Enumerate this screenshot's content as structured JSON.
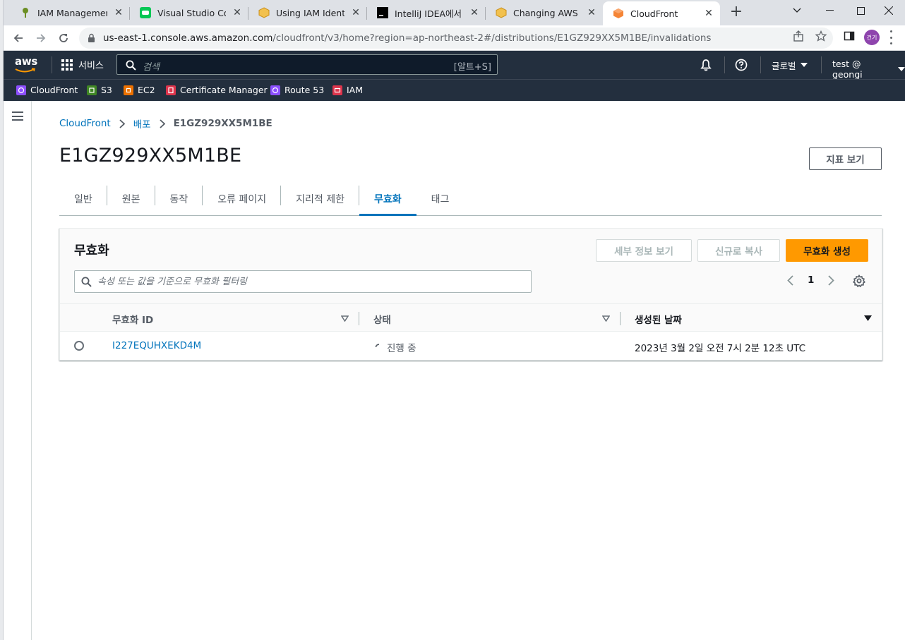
{
  "browser": {
    "tabs": [
      {
        "title": "IAM Management",
        "icon": "iam-favicon-icon"
      },
      {
        "title": "Visual Studio Code",
        "icon": "line-favicon-icon"
      },
      {
        "title": "Using IAM Identity",
        "icon": "aws-docs-favicon-icon"
      },
      {
        "title": "IntelliJ IDEA에서 AV",
        "icon": "terminal-favicon-icon"
      },
      {
        "title": "Changing AWS Reg",
        "icon": "aws-docs-favicon-icon"
      },
      {
        "title": "CloudFront",
        "icon": "cloudfront-favicon-icon",
        "active": true
      }
    ],
    "url_host": "us-east-1.console.aws.amazon.com",
    "url_path": "/cloudfront/v3/home?region=ap-northeast-2#/distributions/E1GZ929XX5M1BE/invalidations",
    "profile_initial": "건기"
  },
  "aws_nav": {
    "logo": "aws",
    "services_label": "서비스",
    "search_placeholder": "검색",
    "search_shortcut": "[알트+S]",
    "region_label": "글로벌",
    "account_label": "test @ geongi"
  },
  "favorites": [
    {
      "label": "CloudFront",
      "color": "#8c4fff"
    },
    {
      "label": "S3",
      "color": "#3f8624"
    },
    {
      "label": "EC2",
      "color": "#ed7100"
    },
    {
      "label": "Certificate Manager",
      "color": "#dd344c"
    },
    {
      "label": "Route 53",
      "color": "#8c4fff"
    },
    {
      "label": "IAM",
      "color": "#dd344c"
    }
  ],
  "breadcrumb": [
    "CloudFront",
    "배포",
    "E1GZ929XX5M1BE"
  ],
  "page": {
    "title": "E1GZ929XX5M1BE",
    "metrics_button": "지표 보기"
  },
  "tabs": [
    {
      "label": "일반"
    },
    {
      "label": "원본"
    },
    {
      "label": "동작"
    },
    {
      "label": "오류 페이지"
    },
    {
      "label": "지리적 제한"
    },
    {
      "label": "무효화",
      "active": true
    },
    {
      "label": "태그"
    }
  ],
  "panel": {
    "title": "무효화",
    "view_details_button": "세부 정보 보기",
    "copy_new_button": "신규로 복사",
    "create_button": "무효화 생성",
    "filter_placeholder": "속성 또는 값을 기준으로 무효화 필터링",
    "current_page": "1",
    "columns": [
      "무효화 ID",
      "상태",
      "생성된 날짜"
    ],
    "rows": [
      {
        "id": "I227EQUHXEKD4M",
        "status": "진행 중",
        "created": "2023년 3월 2일 오전 7시 2분 12초 UTC"
      }
    ]
  },
  "colors": {
    "aws_nav_bg": "#232f3e",
    "link": "#0073bb",
    "primary_button": "#ff9900"
  }
}
